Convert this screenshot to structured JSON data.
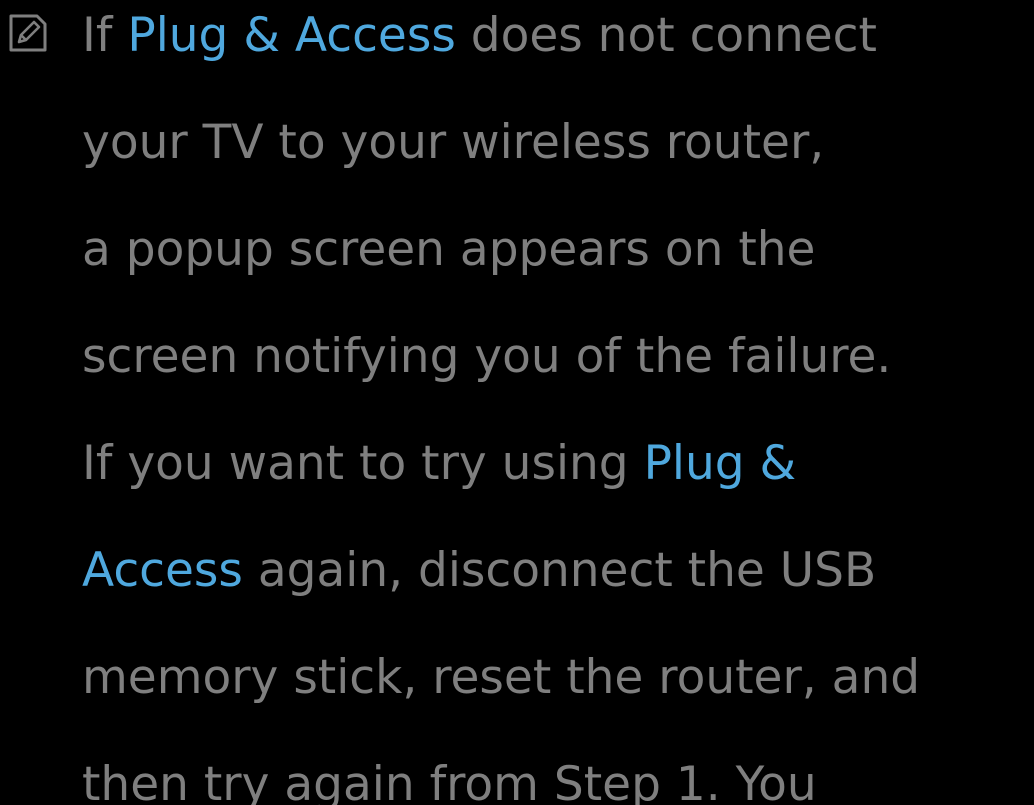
{
  "note": {
    "icon": "note-pencil-icon",
    "lines": [
      [
        "If ",
        "Plug & Access",
        " does not connect"
      ],
      [
        "your TV to your wireless router,"
      ],
      [
        "a popup screen appears on the"
      ],
      [
        "screen notifying you of the failure."
      ],
      [
        "If you want to try using ",
        "Plug &"
      ],
      [
        "Access",
        " again, disconnect the USB"
      ],
      [
        "memory stick, reset the router, and"
      ],
      [
        "then try again from Step 1. You"
      ]
    ]
  },
  "colors": {
    "background": "#000000",
    "text": "#7f7f7f",
    "highlight": "#4fa8de"
  }
}
